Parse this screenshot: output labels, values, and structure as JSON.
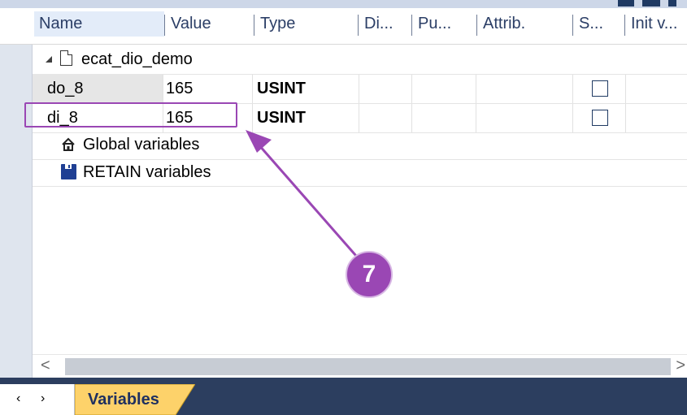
{
  "columns": [
    {
      "id": "name",
      "label": "Name"
    },
    {
      "id": "value",
      "label": "Value"
    },
    {
      "id": "type",
      "label": "Type"
    },
    {
      "id": "di",
      "label": "Di..."
    },
    {
      "id": "pu",
      "label": "Pu..."
    },
    {
      "id": "attrib",
      "label": "Attrib."
    },
    {
      "id": "s",
      "label": "S..."
    },
    {
      "id": "init",
      "label": "Init v..."
    }
  ],
  "tree": {
    "root_label": "ecat_dio_demo",
    "variables": [
      {
        "name": "do_8",
        "value": "165",
        "type": "USINT",
        "checked": false
      },
      {
        "name": "di_8",
        "value": "165",
        "type": "USINT",
        "checked": false
      }
    ],
    "global_label": "Global variables",
    "retain_label": "RETAIN variables"
  },
  "annotation": {
    "step_number": "7",
    "color": "#9a47b4"
  },
  "tabs": {
    "active_label": "Variables",
    "nav_left": "‹",
    "nav_right": "›"
  },
  "scroll": {
    "left": "<",
    "right": ">"
  },
  "icons": [
    "filter-icon",
    "expand-arrow-icon",
    "document-icon",
    "home-icon",
    "save-icon",
    "checkbox-icon"
  ]
}
